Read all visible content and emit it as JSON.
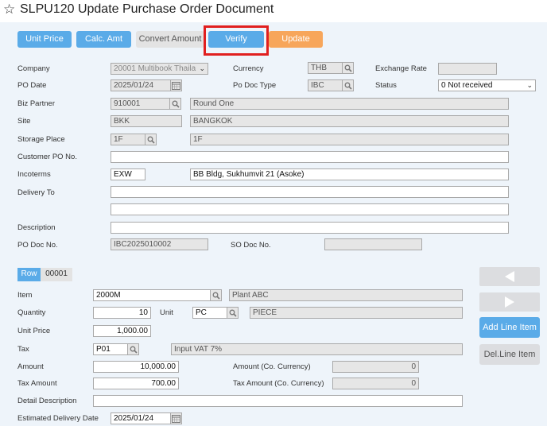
{
  "header": {
    "title": "SLPU120 Update Purchase Order Document"
  },
  "toolbar": {
    "unit_price": "Unit Price",
    "calc_amt": "Calc. Amt",
    "convert_amount": "Convert Amount",
    "verify": "Verify",
    "update": "Update"
  },
  "form": {
    "company_label": "Company",
    "company_value": "20001 Multibook Thaila",
    "currency_label": "Currency",
    "currency_value": "THB",
    "exchange_rate_label": "Exchange Rate",
    "exchange_rate_value": "",
    "po_date_label": "PO Date",
    "po_date_value": "2025/01/24",
    "po_doc_type_label": "Po Doc Type",
    "po_doc_type_value": "IBC",
    "status_label": "Status",
    "status_value": "0 Not received",
    "biz_partner_label": "Biz Partner",
    "biz_partner_code": "910001",
    "biz_partner_name": "Round One",
    "site_label": "Site",
    "site_code": "BKK",
    "site_name": "BANGKOK",
    "storage_place_label": "Storage Place",
    "storage_place_code": "1F",
    "storage_place_name": "1F",
    "customer_po_label": "Customer PO No.",
    "customer_po_value": "",
    "incoterms_label": "Incoterms",
    "incoterms_code": "EXW",
    "incoterms_place": "BB Bldg, Sukhumvit 21 (Asoke)",
    "delivery_to_label": "Delivery To",
    "delivery_to_line1": "",
    "delivery_to_line2": "",
    "description_label": "Description",
    "description_value": "",
    "po_doc_no_label": "PO Doc No.",
    "po_doc_no_value": "IBC2025010002",
    "so_doc_no_label": "SO Doc No.",
    "so_doc_no_value": ""
  },
  "line": {
    "row_tab": "Row",
    "row_number": "00001",
    "item_label": "Item",
    "item_code": "2000M",
    "item_name": "Plant ABC",
    "quantity_label": "Quantity",
    "quantity_value": "10",
    "unit_label": "Unit",
    "unit_code": "PC",
    "unit_name": "PIECE",
    "unit_price_label": "Unit Price",
    "unit_price_value": "1,000.00",
    "tax_label": "Tax",
    "tax_code": "P01",
    "tax_name": "Input VAT 7%",
    "amount_label": "Amount",
    "amount_value": "10,000.00",
    "amount_co_label": "Amount (Co. Currency)",
    "amount_co_value": "0",
    "tax_amount_label": "Tax Amount",
    "tax_amount_value": "700.00",
    "tax_amount_co_label": "Tax Amount (Co. Currency)",
    "tax_amount_co_value": "0",
    "detail_description_label": "Detail Description",
    "detail_description_value": "",
    "est_delivery_label": "Estimated Delivery Date",
    "est_delivery_value": "2025/01/24"
  },
  "side_buttons": {
    "add_line_item": "Add Line Item",
    "del_line_item": "Del.Line Item"
  },
  "icons": {
    "star": "star-outline-icon",
    "lookup": "magnifier-icon",
    "calendar": "calendar-icon",
    "prev": "triangle-left-icon",
    "next": "triangle-right-icon",
    "dropdown": "chevron-down-icon"
  },
  "colors": {
    "primary_button": "#5aabe8",
    "update_button": "#f7a65b",
    "panel_background": "#eef4fa",
    "highlight_box": "#e11f1f"
  }
}
